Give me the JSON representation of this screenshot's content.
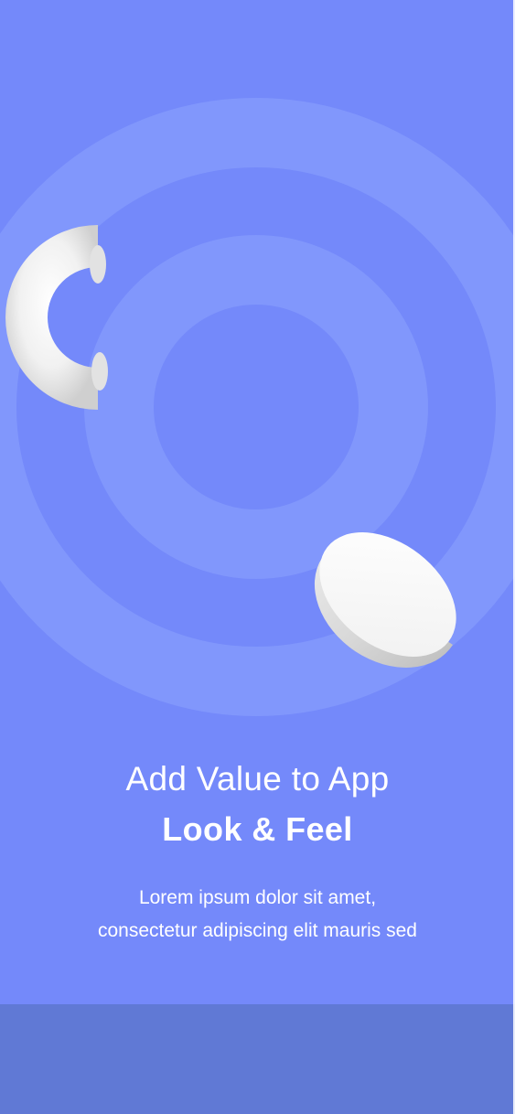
{
  "onboarding": {
    "title_line1": "Add Value to App",
    "title_line2": "Look & Feel",
    "description": "Lorem ipsum dolor sit amet,\nconsectetur adipiscing elit mauris sed"
  },
  "colors": {
    "background": "#7489FA",
    "ring": "#8197FC",
    "bottom_bar": "#6079D5",
    "text": "#FFFFFF",
    "shape": "#F5F5F5"
  },
  "icons": {
    "torus_shape": "half-torus-icon",
    "hemisphere_shape": "hemisphere-icon"
  }
}
